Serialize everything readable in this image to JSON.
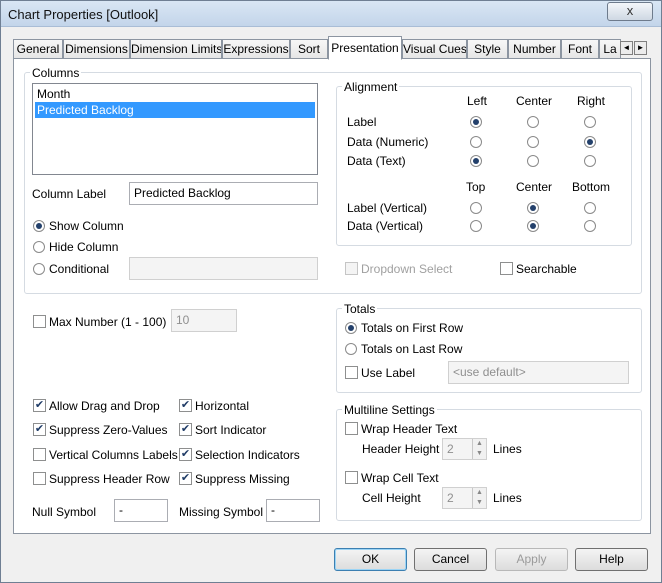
{
  "window": {
    "title": "Chart Properties [Outlook]",
    "close_glyph": "x"
  },
  "tabs": [
    {
      "label": "General"
    },
    {
      "label": "Dimensions"
    },
    {
      "label": "Dimension Limits"
    },
    {
      "label": "Expressions"
    },
    {
      "label": "Sort"
    },
    {
      "label": "Presentation"
    },
    {
      "label": "Visual Cues"
    },
    {
      "label": "Style"
    },
    {
      "label": "Number"
    },
    {
      "label": "Font"
    },
    {
      "label": "La"
    }
  ],
  "active_tab": "Presentation",
  "columns": {
    "title": "Columns",
    "items": [
      "Month",
      "Predicted Backlog"
    ],
    "selected": "Predicted Backlog",
    "column_label_caption": "Column Label",
    "column_label_value": "Predicted Backlog",
    "show_column": "Show Column",
    "hide_column": "Hide Column",
    "conditional": "Conditional",
    "visibility": "Show Column",
    "conditional_value": ""
  },
  "alignment": {
    "title": "Alignment",
    "h_headers": [
      "Left",
      "Center",
      "Right"
    ],
    "v_headers": [
      "Top",
      "Center",
      "Bottom"
    ],
    "rows": [
      {
        "label": "Label",
        "selected": "Left"
      },
      {
        "label": "Data (Numeric)",
        "selected": "Right"
      },
      {
        "label": "Data (Text)",
        "selected": "Left"
      }
    ],
    "vrows": [
      {
        "label": "Label (Vertical)",
        "selected": "Center"
      },
      {
        "label": "Data (Vertical)",
        "selected": "Center"
      }
    ]
  },
  "dropdown_select": {
    "label": "Dropdown Select",
    "checked": false,
    "enabled": false
  },
  "searchable": {
    "label": "Searchable",
    "checked": false
  },
  "max_number": {
    "label": "Max Number (1 - 100)",
    "checked": false,
    "value": "10"
  },
  "totals": {
    "title": "Totals",
    "first": "Totals on First Row",
    "last": "Totals on Last Row",
    "selected": "Totals on First Row",
    "use_label": "Use Label",
    "use_label_checked": false,
    "use_label_value": "<use default>"
  },
  "options_left": [
    {
      "label": "Allow Drag and Drop",
      "checked": true
    },
    {
      "label": "Suppress Zero-Values",
      "checked": true
    },
    {
      "label": "Vertical Columns Labels",
      "checked": false
    },
    {
      "label": "Suppress Header Row",
      "checked": false
    }
  ],
  "options_right": [
    {
      "label": "Horizontal",
      "checked": true
    },
    {
      "label": "Sort Indicator",
      "checked": true
    },
    {
      "label": "Selection Indicators",
      "checked": true
    },
    {
      "label": "Suppress Missing",
      "checked": true
    }
  ],
  "check_glyph": "✔",
  "null_symbol": {
    "label": "Null Symbol",
    "value": "-"
  },
  "missing_symbol": {
    "label": "Missing Symbol",
    "value": "-"
  },
  "multiline": {
    "title": "Multiline Settings",
    "wrap_header": "Wrap Header Text",
    "wrap_header_checked": false,
    "header_height_label": "Header Height",
    "header_height": "2",
    "header_lines": "Lines",
    "wrap_cell": "Wrap Cell Text",
    "wrap_cell_checked": false,
    "cell_height_label": "Cell Height",
    "cell_height": "2",
    "cell_lines": "Lines"
  },
  "buttons": {
    "ok": "OK",
    "cancel": "Cancel",
    "apply": "Apply",
    "help": "Help"
  },
  "icons": {
    "tab_left": "◄",
    "tab_right": "►",
    "spin_up": "▲",
    "spin_down": "▼"
  }
}
